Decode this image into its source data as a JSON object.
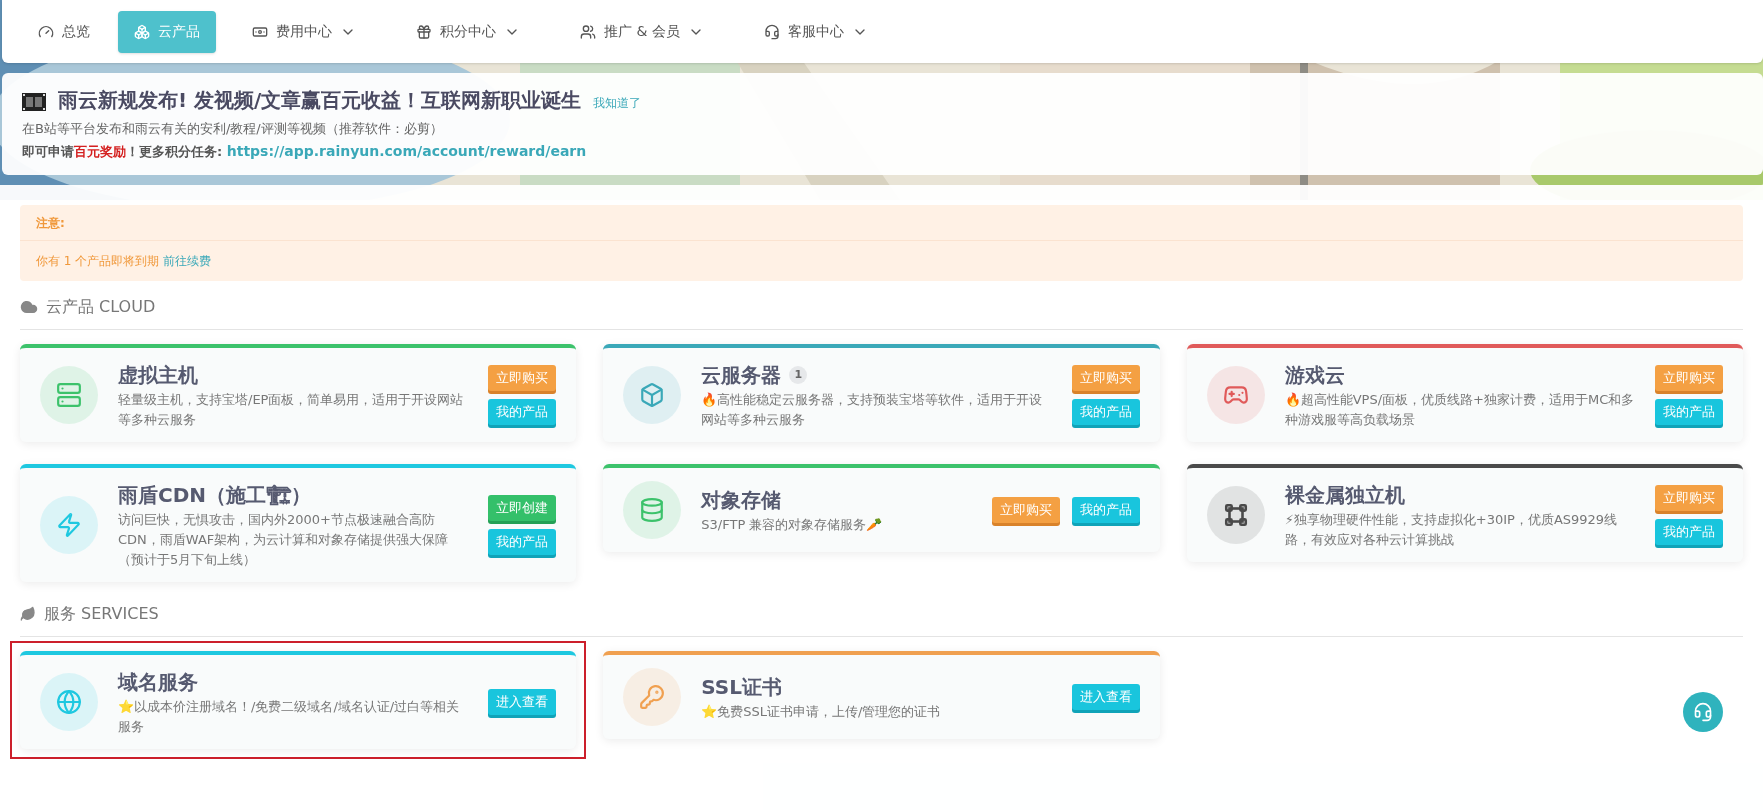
{
  "nav": [
    {
      "label": "总览",
      "kind": "overview",
      "selected": false,
      "dropdown": false
    },
    {
      "label": "云产品",
      "kind": "cloud",
      "selected": true,
      "dropdown": false
    },
    {
      "label": "费用中心",
      "kind": "billing",
      "selected": false,
      "dropdown": true
    },
    {
      "label": "积分中心",
      "kind": "points",
      "selected": false,
      "dropdown": true
    },
    {
      "label": "推广 & 会员",
      "kind": "members",
      "selected": false,
      "dropdown": true
    },
    {
      "label": "客服中心",
      "kind": "support",
      "selected": false,
      "dropdown": true
    }
  ],
  "banner": {
    "title": "雨云新规发布! 发视频/文章赢百元收益！互联网新职业诞生",
    "dismiss": "我知道了",
    "line": "在B站等平台发布和雨云有关的安利/教程/评测等视频（推荐软件：必剪）",
    "reward_before": "即可申请",
    "reward_highlight": "百元奖励",
    "reward_after": "！更多积分任务: ",
    "link": "https://app.rainyun.com/account/reward/earn"
  },
  "notice": {
    "title": "注意:",
    "message": "你有 1 个产品即将到期",
    "link": "前往续费"
  },
  "sections": [
    {
      "title": "云产品 CLOUD",
      "kind": "cloud",
      "cards": [
        {
          "kind": "hosting",
          "title": "虚拟主机",
          "color": "#3cc26b",
          "description": "轻量级主机，支持宝塔/EP面板，简单易用，适用于开设网站等多种云服务",
          "buttons": [
            {
              "label": "立即购买",
              "kind": "buy"
            },
            {
              "label": "我的产品",
              "kind": "mine"
            }
          ]
        },
        {
          "kind": "server",
          "title": "云服务器",
          "badge": "1",
          "color": "#3aa8b8",
          "description": "🔥高性能稳定云服务器，支持预装宝塔等软件，适用于开设网站等多种云服务",
          "buttons": [
            {
              "label": "立即购买",
              "kind": "buy"
            },
            {
              "label": "我的产品",
              "kind": "mine"
            }
          ]
        },
        {
          "kind": "game",
          "title": "游戏云",
          "color": "#e05a5a",
          "description": "🔥超高性能VPS/面板，优质线路+独家计费，适用于MC和多种游戏服等高负载场景",
          "buttons": [
            {
              "label": "立即购买",
              "kind": "buy"
            },
            {
              "label": "我的产品",
              "kind": "mine"
            }
          ]
        },
        {
          "kind": "cdn",
          "title": "雨盾CDN（施工🏗）",
          "color": "#1ec8e0",
          "description": "访问巨快，无惧攻击，国内外2000+节点极速融合高防CDN，雨盾WAF架构，为云计算和对象存储提供强大保障（预计于5月下旬上线）",
          "buttons": [
            {
              "label": "立即创建",
              "kind": "create"
            },
            {
              "label": "我的产品",
              "kind": "mine"
            }
          ]
        },
        {
          "kind": "storage",
          "title": "对象存储",
          "color": "#3cc26b",
          "description": "S3/FTP 兼容的对象存储服务🥕",
          "buttons": [
            {
              "label": "立即购买",
              "kind": "buy"
            },
            {
              "label": "我的产品",
              "kind": "mine"
            }
          ]
        },
        {
          "kind": "baremetal",
          "title": "裸金属独立机",
          "color": "#4a4a4a",
          "description": "⚡独享物理硬件性能，支持虚拟化+30IP，优质AS9929线路，有效应对各种云计算挑战",
          "buttons": [
            {
              "label": "立即购买",
              "kind": "buy"
            },
            {
              "label": "我的产品",
              "kind": "mine"
            }
          ]
        }
      ]
    },
    {
      "title": "服务 SERVICES",
      "kind": "services",
      "cards": [
        {
          "kind": "domain",
          "title": "域名服务",
          "color": "#1ec8e0",
          "highlighted": true,
          "description": "⭐以成本价注册域名！/免费二级域名/域名认证/过白等相关服务",
          "buttons": [
            {
              "label": "进入查看",
              "kind": "view"
            }
          ]
        },
        {
          "kind": "ssl",
          "title": "SSL证书",
          "color": "#f0a050",
          "highlighted": false,
          "description": "⭐免费SSL证书申请，上传/管理您的证书",
          "buttons": [
            {
              "label": "进入查看",
              "kind": "view"
            }
          ]
        }
      ]
    }
  ]
}
